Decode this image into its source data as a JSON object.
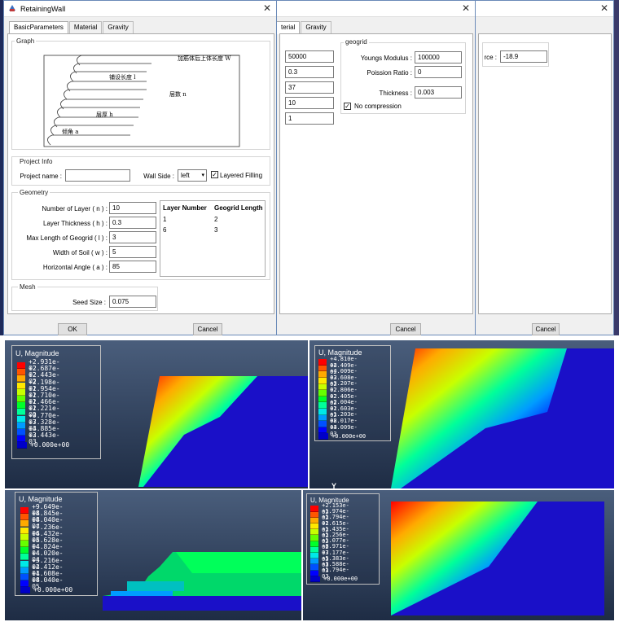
{
  "dialog1": {
    "title": "RetainingWall",
    "tabs": [
      "BasicParameters",
      "Material",
      "Gravity"
    ],
    "graph_group": "Graph",
    "graph_labels": {
      "top": "加筋体后上体长度 W",
      "length": "铺设长度 l",
      "layers": "层数 n",
      "thickness": "层厚 h",
      "angle": "倾角 a"
    },
    "project_info_group": "Project Info",
    "project_name_label": "Project name :",
    "project_name_value": "",
    "wall_side_label": "Wall Side :",
    "wall_side_value": "left",
    "layered_filling_label": "Layered Filling",
    "layered_filling_checked": true,
    "geometry_group": "Geometry",
    "fields": [
      {
        "label": "Number of Layer ( n ) :",
        "value": "10"
      },
      {
        "label": "Layer Thickness ( h ) :",
        "value": "0.3"
      },
      {
        "label": "Max Length of Geogrid ( l ) :",
        "value": "3"
      },
      {
        "label": "Width of Soil ( w ) :",
        "value": "5"
      },
      {
        "label": "Horizontal Angle ( a ) :",
        "value": "85"
      }
    ],
    "table_headers": [
      "Layer Number",
      "Geogrid Length"
    ],
    "table_rows": [
      [
        "1",
        "2"
      ],
      [
        "6",
        "3"
      ]
    ],
    "mesh_group": "Mesh",
    "seed_label": "Seed Size :",
    "seed_value": "0.075",
    "ok_label": "OK",
    "cancel_label": "Cancel"
  },
  "dialog2": {
    "tabs": [
      "terial",
      "Gravity"
    ],
    "values": [
      "50000",
      "0.3",
      "37",
      "10",
      "1"
    ],
    "geogrid_group": "geogrid",
    "youngs_label": "Youngs Modulus :",
    "youngs_value": "100000",
    "poisson_label": "Poission Ratio :",
    "poisson_value": "0",
    "thickness_label": "Thickness :",
    "thickness_value": "0.003",
    "no_compression_label": "No compression",
    "no_compression_checked": true,
    "cancel_label": "Cancel"
  },
  "dialog3": {
    "force_label": "rce :",
    "force_value": "-18.9",
    "cancel_label": "Cancel"
  },
  "results": [
    {
      "title": "U, Magnitude",
      "values": [
        "+2.931e-02",
        "+2.687e-02",
        "+2.443e-02",
        "+2.198e-02",
        "+1.954e-02",
        "+1.710e-02",
        "+1.466e-02",
        "+1.221e-02",
        "+9.770e-03",
        "+7.328e-03",
        "+4.885e-03",
        "+2.443e-03",
        "+0.000e+00"
      ]
    },
    {
      "title": "U, Magnitude",
      "values": [
        "+4.810e-02",
        "+4.409e-02",
        "+4.009e-02",
        "+3.608e-02",
        "+3.207e-02",
        "+2.806e-02",
        "+2.405e-02",
        "+2.004e-02",
        "+1.603e-02",
        "+1.203e-02",
        "+8.017e-03",
        "+4.009e-03",
        "+0.000e+00"
      ]
    },
    {
      "title": "U, Magnitude",
      "values": [
        "+9.649e-04",
        "+8.845e-04",
        "+8.040e-04",
        "+7.236e-04",
        "+6.432e-04",
        "+5.628e-04",
        "+4.824e-04",
        "+4.020e-04",
        "+3.216e-04",
        "+2.412e-04",
        "+1.608e-04",
        "+8.040e-05",
        "+0.000e+00"
      ]
    },
    {
      "title": "U, Magnitude",
      "values": [
        "+2.153e-02",
        "+1.974e-02",
        "+1.794e-02",
        "+1.615e-02",
        "+1.435e-02",
        "+1.256e-02",
        "+1.077e-02",
        "+8.971e-03",
        "+7.177e-03",
        "+5.383e-03",
        "+3.588e-03",
        "+1.794e-03",
        "+0.000e+00"
      ]
    }
  ],
  "axis_label": "Y",
  "legend_colors": [
    "#ff0000",
    "#ff5500",
    "#ffaa00",
    "#ffe800",
    "#c8ff00",
    "#66ff00",
    "#00ff2a",
    "#00ff9a",
    "#00e8e8",
    "#009cff",
    "#0050ff",
    "#0000ff",
    "#0000c8"
  ]
}
